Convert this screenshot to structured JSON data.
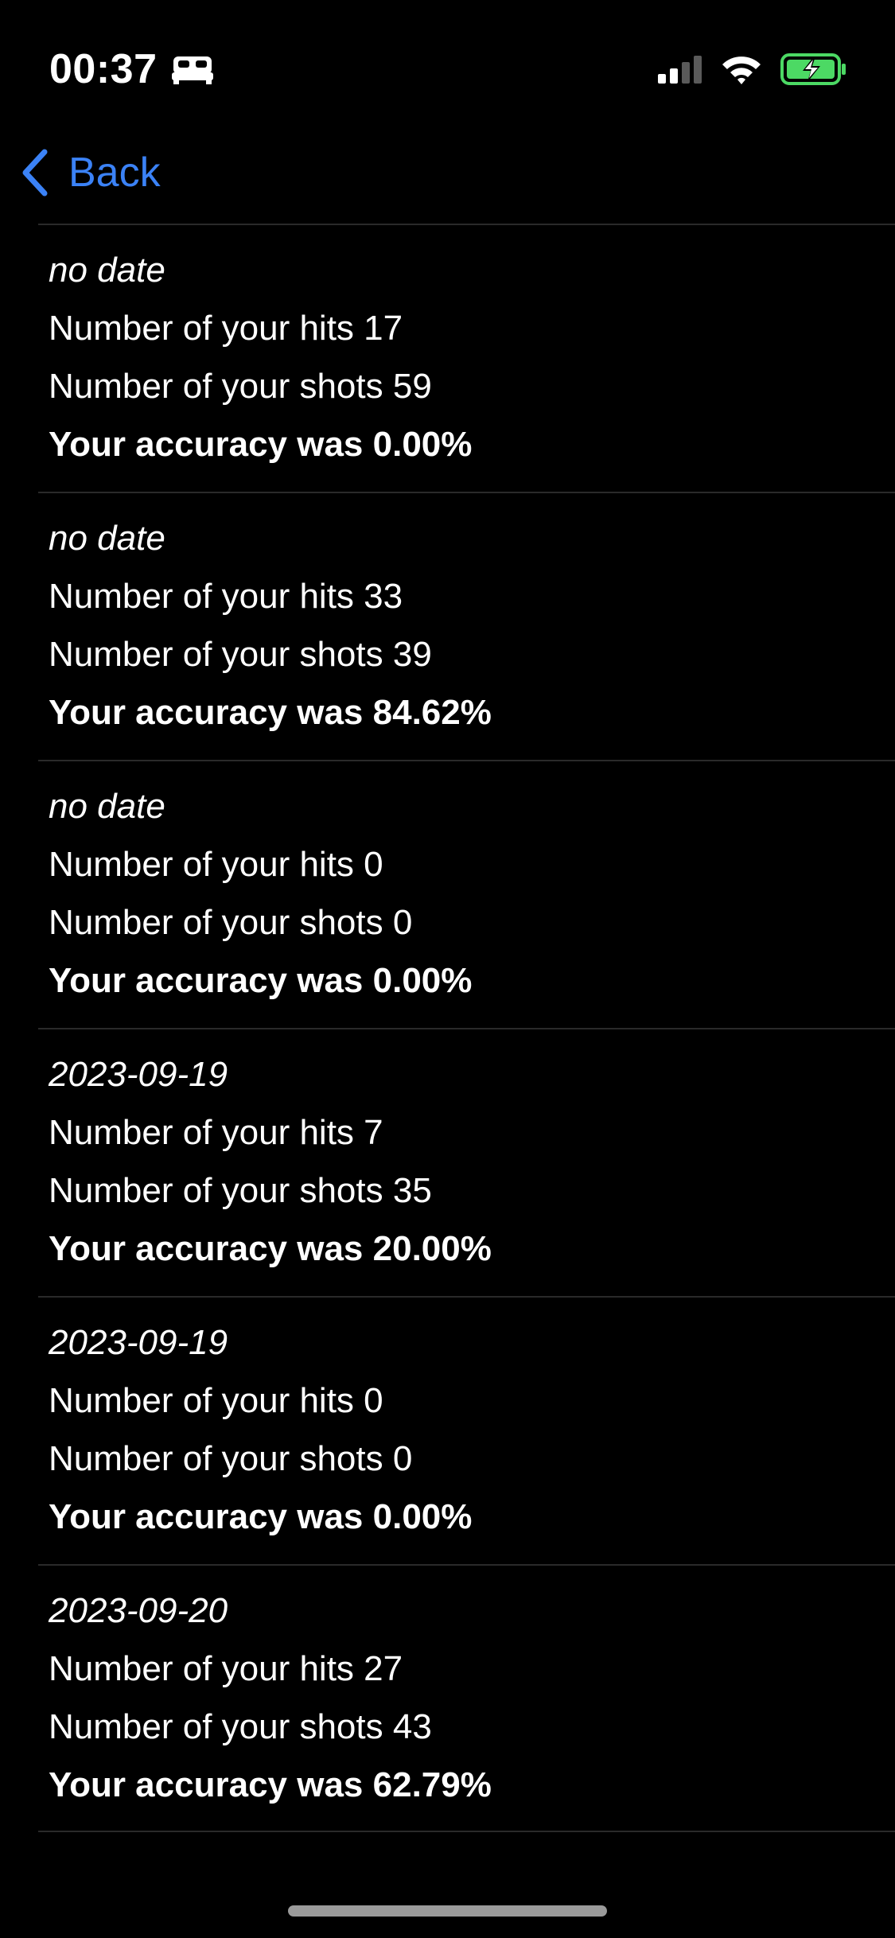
{
  "status_bar": {
    "time": "00:37",
    "icons": {
      "sleep": "bed-icon",
      "cellular": "cellular-signal-icon",
      "wifi": "wifi-icon",
      "battery": "battery-charging-icon"
    },
    "battery_color": "#4cd964"
  },
  "nav": {
    "back_label": "Back",
    "accent_color": "#3b82f6"
  },
  "records": [
    {
      "date": "no date",
      "hits": "Number of your hits 17",
      "shots": "Number of your shots 59",
      "accuracy": "Your accuracy was 0.00%"
    },
    {
      "date": "no date",
      "hits": "Number of your hits 33",
      "shots": "Number of your shots 39",
      "accuracy": "Your accuracy was 84.62%"
    },
    {
      "date": "no date",
      "hits": "Number of your hits 0",
      "shots": "Number of your shots 0",
      "accuracy": "Your accuracy was 0.00%"
    },
    {
      "date": "2023-09-19",
      "hits": "Number of your hits 7",
      "shots": "Number of your shots 35",
      "accuracy": "Your accuracy was 20.00%"
    },
    {
      "date": "2023-09-19",
      "hits": "Number of your hits 0",
      "shots": "Number of your shots 0",
      "accuracy": "Your accuracy was 0.00%"
    },
    {
      "date": "2023-09-20",
      "hits": "Number of your hits 27",
      "shots": "Number of your shots 43",
      "accuracy": "Your accuracy was 62.79%"
    }
  ]
}
